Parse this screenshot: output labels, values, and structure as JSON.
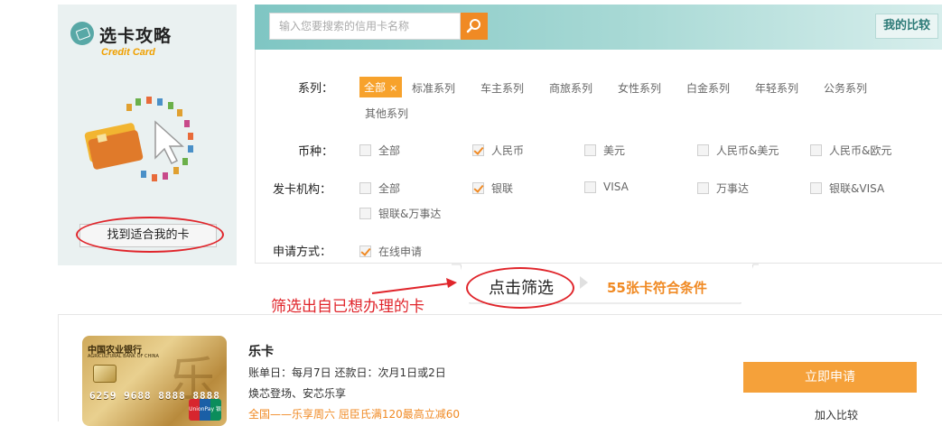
{
  "promo": {
    "title": "选卡攻略",
    "subtitle": "Credit Card",
    "find_button": "找到适合我的卡"
  },
  "search": {
    "placeholder": "输入您要搜索的信用卡名称",
    "compare_label": "我的比较"
  },
  "filters": {
    "series": {
      "label": "系列：",
      "selected": "全部",
      "options": [
        "标准系列",
        "车主系列",
        "商旅系列",
        "女性系列",
        "白金系列",
        "年轻系列",
        "公务系列",
        "其他系列"
      ]
    },
    "currency": {
      "label": "币种：",
      "options": [
        {
          "text": "全部",
          "checked": false
        },
        {
          "text": "人民币",
          "checked": true
        },
        {
          "text": "美元",
          "checked": false
        },
        {
          "text": "人民币&美元",
          "checked": false
        },
        {
          "text": "人民币&欧元",
          "checked": false
        }
      ]
    },
    "issuer": {
      "label": "发卡机构：",
      "options": [
        {
          "text": "全部",
          "checked": false
        },
        {
          "text": "银联",
          "checked": true
        },
        {
          "text": "VISA",
          "checked": false
        },
        {
          "text": "万事达",
          "checked": false
        },
        {
          "text": "银联&VISA",
          "checked": false
        },
        {
          "text": "银联&万事达",
          "checked": false
        }
      ]
    },
    "apply_method": {
      "label": "申请方式：",
      "options": [
        {
          "text": "在线申请",
          "checked": true
        }
      ]
    }
  },
  "result": {
    "tab_label": "点击筛选",
    "match_text": "55张卡符合条件",
    "annotation": "筛选出自已想办理的卡"
  },
  "card": {
    "name": "乐卡",
    "billing": "账单日：每月7日 还款日：次月1日或2日",
    "feature": "焕芯登场、安芯乐享",
    "promo": "全国——乐享周六 屈臣氏满120最高立减60",
    "apply_button": "立即申请",
    "add_compare": "加入比较",
    "image": {
      "bank_name": "中国农业银行",
      "bank_en": "AGRICULTURAL BANK OF CHINA",
      "number": "6259 9688 8888 8888",
      "network": "UnionPay 银联",
      "art_char": "乐"
    }
  },
  "colors": {
    "accent": "#f08a24",
    "annotation_red": "#e0252b",
    "teal": "#58a8a6"
  }
}
